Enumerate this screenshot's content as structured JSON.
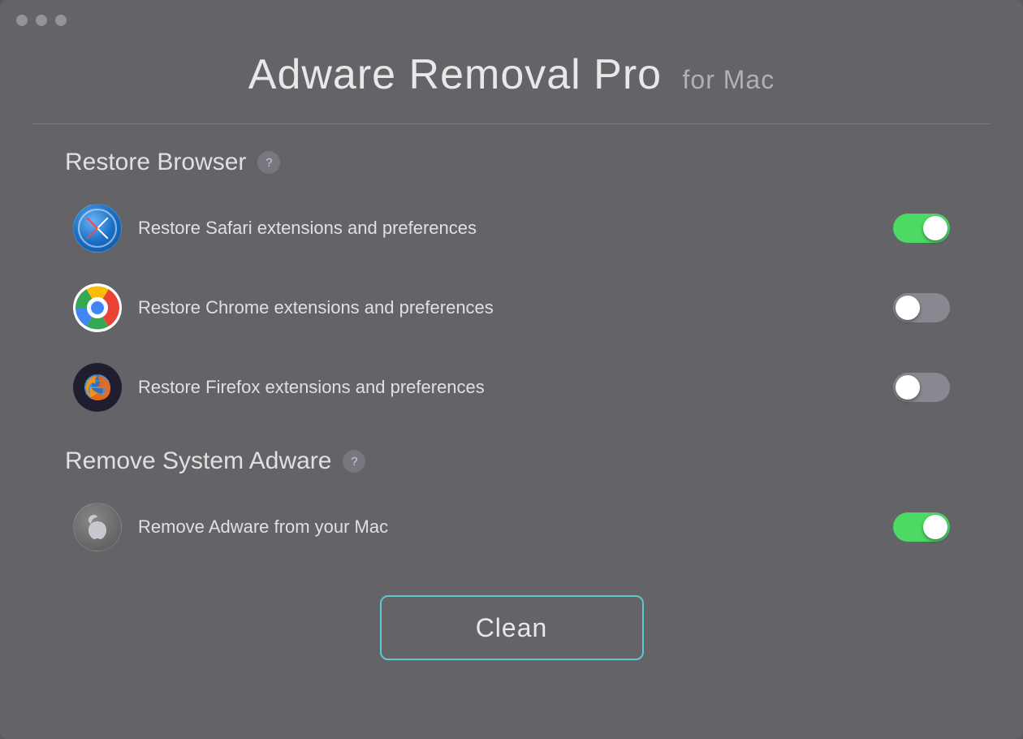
{
  "window": {
    "title": "Adware Removal Pro for Mac",
    "title_main": "Adware Removal Pro",
    "title_suffix": "for Mac"
  },
  "traffic_lights": [
    "close",
    "minimize",
    "maximize"
  ],
  "sections": [
    {
      "id": "restore-browser",
      "title": "Restore Browser",
      "has_help": true,
      "options": [
        {
          "id": "safari",
          "icon": "safari-icon",
          "label": "Restore Safari extensions and preferences",
          "enabled": true
        },
        {
          "id": "chrome",
          "icon": "chrome-icon",
          "label": "Restore Chrome extensions and preferences",
          "enabled": false
        },
        {
          "id": "firefox",
          "icon": "firefox-icon",
          "label": "Restore Firefox extensions and preferences",
          "enabled": false
        }
      ]
    },
    {
      "id": "remove-adware",
      "title": "Remove System Adware",
      "has_help": true,
      "options": [
        {
          "id": "mac",
          "icon": "mac-icon",
          "label": "Remove Adware from your Mac",
          "enabled": true
        }
      ]
    }
  ],
  "clean_button": {
    "label": "Clean"
  }
}
